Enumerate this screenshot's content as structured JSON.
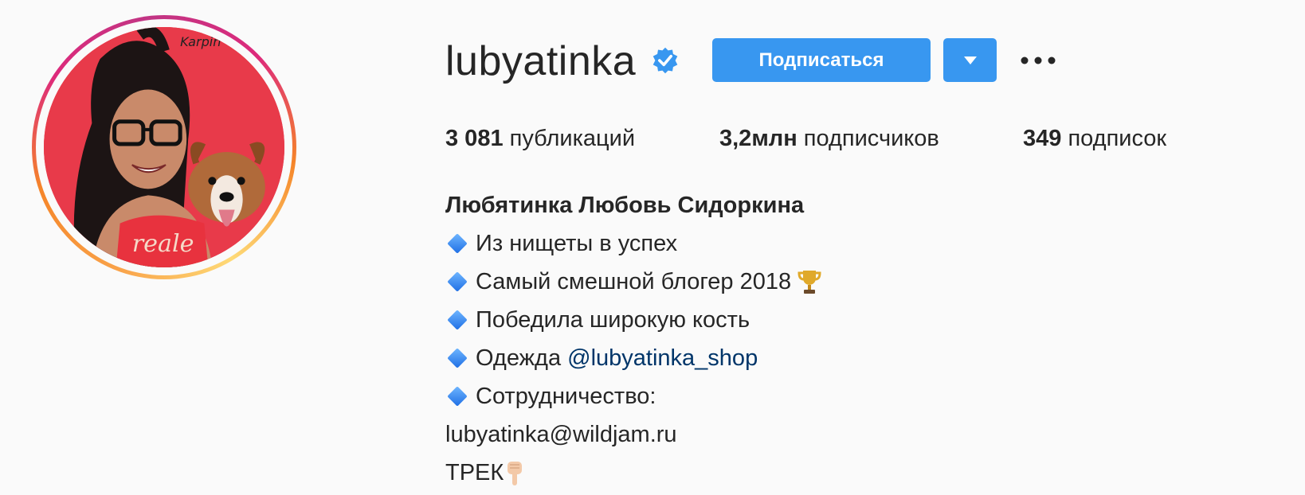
{
  "profile": {
    "username": "lubyatinka",
    "verified": true,
    "follow_label": "Подписаться",
    "avatar_watermark": "Karpin",
    "avatar_shirt_text": "reale"
  },
  "stats": {
    "posts_count": "3 081",
    "posts_label": "публикаций",
    "followers_count": "3,2млн",
    "followers_label": "подписчиков",
    "following_count": "349",
    "following_label": "подписок"
  },
  "bio": {
    "full_name": "Любятинка Любовь Сидоркина",
    "lines": [
      "Из нищеты в успех",
      "Самый смешной блогер 2018",
      "Победила широкую кость",
      "Одежда",
      "Сотрудничество:"
    ],
    "shop_link": "@lubyatinka_shop",
    "email": "lubyatinka@wildjam.ru",
    "track": "ТРЕК"
  },
  "colors": {
    "accent": "#3897f0",
    "link": "#003569",
    "text": "#262626",
    "background": "#fafafa"
  },
  "icons": {
    "verified": "verified-badge-icon",
    "dropdown": "triangle-down-icon",
    "more": "ellipsis-icon",
    "bullet": "blue-diamond-icon",
    "trophy": "trophy-icon",
    "hand": "pointing-down-icon"
  }
}
